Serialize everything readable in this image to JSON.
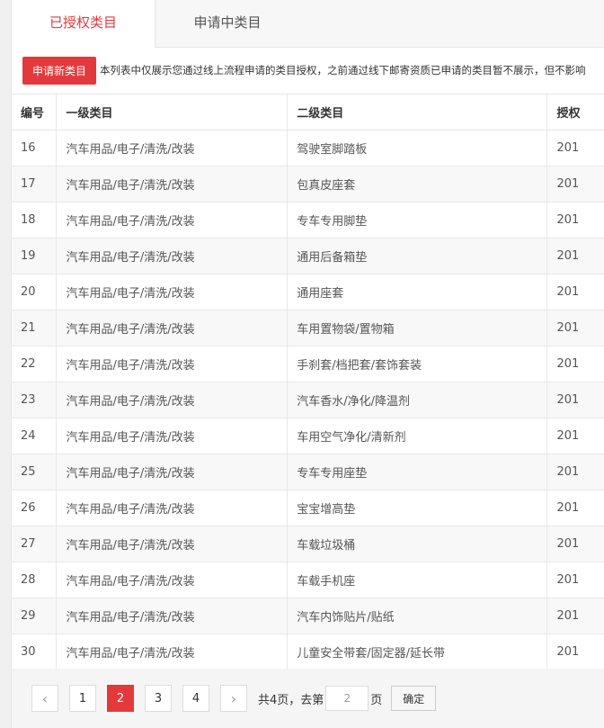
{
  "tabs": [
    {
      "label": "已授权类目"
    },
    {
      "label": "申请中类目"
    }
  ],
  "apply_button": "申请新类目",
  "notice": "本列表中仅展示您通过线上流程申请的类目授权，之前通过线下邮寄资质已申请的类目暂不展示，但不影响",
  "table": {
    "headers": [
      "编号",
      "一级类目",
      "二级类目",
      "授权"
    ],
    "rows": [
      {
        "id": "16",
        "cat1": "汽车用品/电子/清洗/改装",
        "cat2": "驾驶室脚踏板",
        "auth": "201"
      },
      {
        "id": "17",
        "cat1": "汽车用品/电子/清洗/改装",
        "cat2": "包真皮座套",
        "auth": "201"
      },
      {
        "id": "18",
        "cat1": "汽车用品/电子/清洗/改装",
        "cat2": "专车专用脚垫",
        "auth": "201"
      },
      {
        "id": "19",
        "cat1": "汽车用品/电子/清洗/改装",
        "cat2": "通用后备箱垫",
        "auth": "201"
      },
      {
        "id": "20",
        "cat1": "汽车用品/电子/清洗/改装",
        "cat2": "通用座套",
        "auth": "201"
      },
      {
        "id": "21",
        "cat1": "汽车用品/电子/清洗/改装",
        "cat2": "车用置物袋/置物箱",
        "auth": "201"
      },
      {
        "id": "22",
        "cat1": "汽车用品/电子/清洗/改装",
        "cat2": "手刹套/档把套/套饰套装",
        "auth": "201"
      },
      {
        "id": "23",
        "cat1": "汽车用品/电子/清洗/改装",
        "cat2": "汽车香水/净化/降温剂",
        "auth": "201"
      },
      {
        "id": "24",
        "cat1": "汽车用品/电子/清洗/改装",
        "cat2": "车用空气净化/清新剂",
        "auth": "201"
      },
      {
        "id": "25",
        "cat1": "汽车用品/电子/清洗/改装",
        "cat2": "专车专用座垫",
        "auth": "201"
      },
      {
        "id": "26",
        "cat1": "汽车用品/电子/清洗/改装",
        "cat2": "宝宝增高垫",
        "auth": "201"
      },
      {
        "id": "27",
        "cat1": "汽车用品/电子/清洗/改装",
        "cat2": "车载垃圾桶",
        "auth": "201"
      },
      {
        "id": "28",
        "cat1": "汽车用品/电子/清洗/改装",
        "cat2": "车载手机座",
        "auth": "201"
      },
      {
        "id": "29",
        "cat1": "汽车用品/电子/清洗/改装",
        "cat2": "汽车内饰贴片/贴纸",
        "auth": "201"
      },
      {
        "id": "30",
        "cat1": "汽车用品/电子/清洗/改装",
        "cat2": "儿童安全带套/固定器/延长带",
        "auth": "201"
      }
    ]
  },
  "pager": {
    "prev": "‹",
    "next": "›",
    "pages": [
      "1",
      "2",
      "3",
      "4"
    ],
    "total_prefix": "共4页，去第",
    "input_value": "2",
    "page_suffix": "页",
    "confirm": "确定"
  },
  "colors": {
    "accent": "#e4393c"
  }
}
